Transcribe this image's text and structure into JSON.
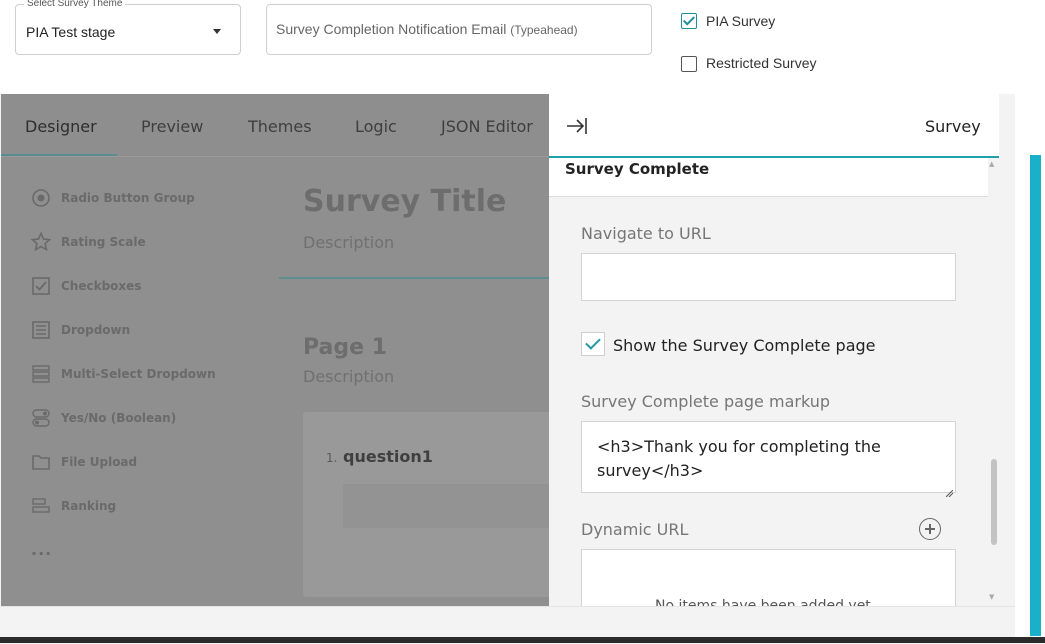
{
  "top": {
    "theme_label": "Select Survey Theme",
    "theme_value": "PIA Test stage",
    "email_placeholder": "Survey Completion Notification Email",
    "email_hint": "(Typeahead)",
    "pia_survey_label": "PIA Survey",
    "pia_survey_checked": true,
    "restricted_survey_label": "Restricted Survey",
    "restricted_survey_checked": false
  },
  "designer": {
    "tabs": [
      {
        "label": "Designer",
        "active": true
      },
      {
        "label": "Preview",
        "active": false
      },
      {
        "label": "Themes",
        "active": false
      },
      {
        "label": "Logic",
        "active": false
      },
      {
        "label": "JSON Editor",
        "active": false
      }
    ],
    "toolbox": [
      {
        "label": "Radio Button Group",
        "icon": "radio-button-icon"
      },
      {
        "label": "Rating Scale",
        "icon": "star-icon"
      },
      {
        "label": "Checkboxes",
        "icon": "checkbox-icon"
      },
      {
        "label": "Dropdown",
        "icon": "dropdown-icon"
      },
      {
        "label": "Multi-Select Dropdown",
        "icon": "multi-select-icon"
      },
      {
        "label": "Yes/No (Boolean)",
        "icon": "toggle-icon"
      },
      {
        "label": "File Upload",
        "icon": "folder-icon"
      },
      {
        "label": "Ranking",
        "icon": "ranking-icon"
      }
    ],
    "more": "...",
    "survey_title": "Survey Title",
    "survey_description": "Description",
    "page_title": "Page 1",
    "page_description": "Description",
    "question_number": "1.",
    "question_title": "question1"
  },
  "panel": {
    "title": "Survey",
    "section_title": "Survey Complete",
    "navigate_url_label": "Navigate to URL",
    "navigate_url_value": "",
    "show_complete_label": "Show the Survey Complete page",
    "show_complete_checked": true,
    "markup_label": "Survey Complete page markup",
    "markup_value": "<h3>Thank you for completing the survey</h3>",
    "dynamic_url_label": "Dynamic URL",
    "dynamic_url_empty": "No items have been added yet"
  },
  "colors": {
    "accent": "#1fa0ad",
    "scrollbar": "#1ab0c9",
    "overlay": "#8f8f8f"
  }
}
